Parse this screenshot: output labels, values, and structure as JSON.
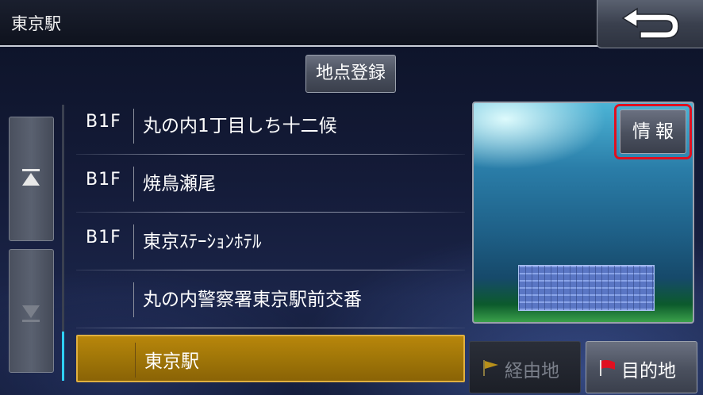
{
  "header": {
    "title": "東京駅"
  },
  "actions": {
    "register_label": "地点登録",
    "info_label": "情報",
    "via_label": "経由地",
    "destination_label": "目的地"
  },
  "list": {
    "rows": [
      {
        "floor": "B1F",
        "name": "丸の内1丁目しち十二候"
      },
      {
        "floor": "B1F",
        "name": "焼鳥瀬尾"
      },
      {
        "floor": "B1F",
        "name": "東京ｽﾃｰｼｮﾝﾎﾃﾙ"
      },
      {
        "floor": "",
        "name": "丸の内警察署東京駅前交番"
      },
      {
        "floor": "",
        "name": "東京駅",
        "selected": true
      }
    ]
  },
  "icons": {
    "back": "back-arrow-icon",
    "scroll_up": "scroll-top-icon",
    "scroll_down": "scroll-down-icon",
    "via_flag": "yellow-flag-icon",
    "dest_flag": "red-flag-icon"
  },
  "colors": {
    "accent": "#2fd0ff",
    "selected_row": "#a07608",
    "highlight_outline": "#e01020",
    "dest_flag": "#e01020",
    "via_flag": "#b8901a"
  }
}
